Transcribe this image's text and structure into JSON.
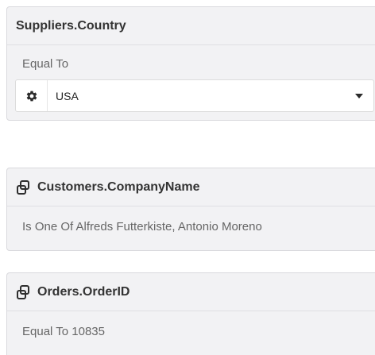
{
  "filters": [
    {
      "title": "Suppliers.Country",
      "condition": "Equal To",
      "selected_value": "USA",
      "icon": "gear-icon"
    },
    {
      "title": "Customers.CompanyName",
      "condition": "Is One Of Alfreds Futterkiste, Antonio Moreno",
      "icon": "link-icon"
    },
    {
      "title": "Orders.OrderID",
      "condition": "Equal To 10835",
      "icon": "link-icon"
    }
  ],
  "colors": {
    "card_bg": "#f2f2f4",
    "card_border": "#d9d9dd",
    "title_text": "#333333",
    "sub_text": "#666666"
  }
}
